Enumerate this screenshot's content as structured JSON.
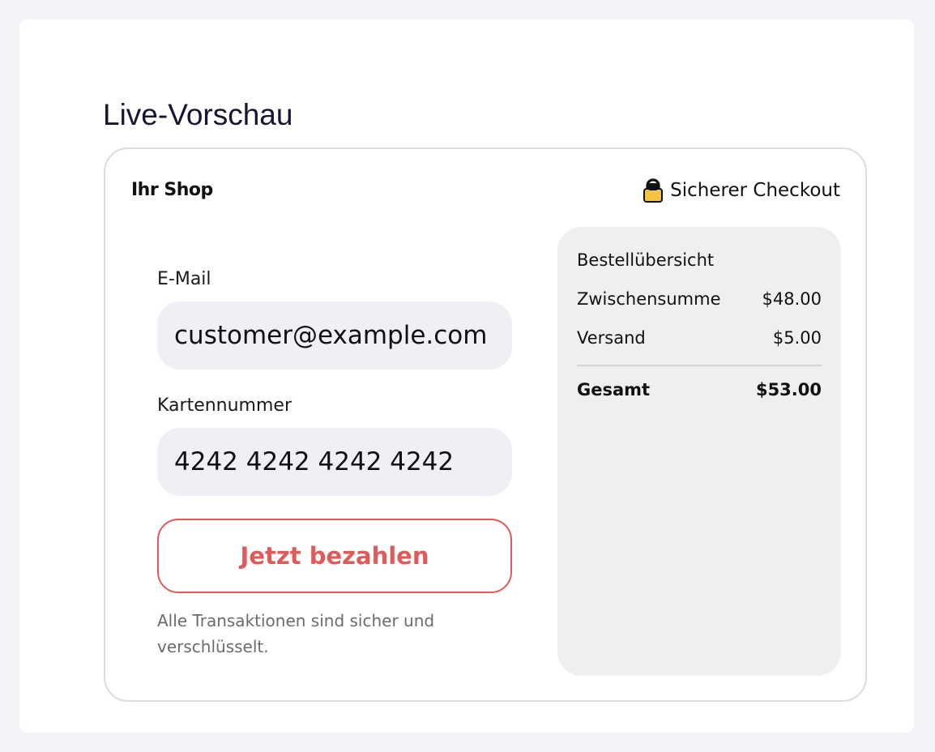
{
  "page_title": "Live-Vorschau",
  "header": {
    "shop_name": "Ihr Shop",
    "secure_label": "Sicherer Checkout",
    "secure_icon": "lock-icon"
  },
  "form": {
    "email_label": "E-Mail",
    "email_value": "customer@example.com",
    "card_label": "Kartennummer",
    "card_value": "4242 4242 4242 4242",
    "pay_label": "Jetzt bezahlen",
    "note": "Alle Transaktionen sind sicher und verschlüsselt."
  },
  "summary": {
    "title": "Bestellübersicht",
    "subtotal_label": "Zwischensumme",
    "subtotal_value": "$48.00",
    "shipping_label": "Versand",
    "shipping_value": "$5.00",
    "total_label": "Gesamt",
    "total_value": "$53.00"
  },
  "colors": {
    "accent": "#e05a5a",
    "input_bg": "#eef0f5",
    "summary_bg": "#efefed",
    "page_bg": "#f2f3f6",
    "lock_body": "#f5c542"
  }
}
